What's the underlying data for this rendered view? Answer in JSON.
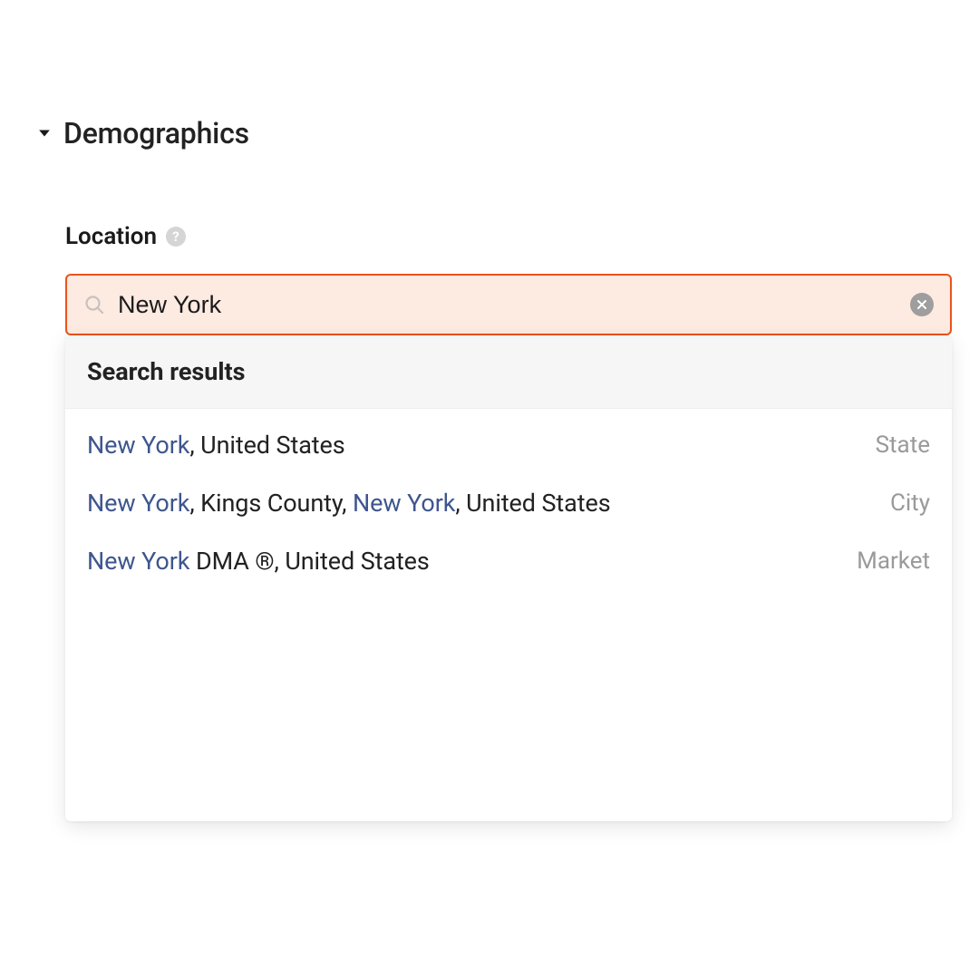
{
  "section": {
    "title": "Demographics"
  },
  "field": {
    "label": "Location",
    "help_symbol": "?"
  },
  "search": {
    "query": "New York",
    "placeholder": ""
  },
  "dropdown": {
    "header": "Search results"
  },
  "results": [
    {
      "segments": [
        {
          "text": "New York",
          "highlight": true
        },
        {
          "text": ", United States",
          "highlight": false
        }
      ],
      "type": "State"
    },
    {
      "segments": [
        {
          "text": "New York",
          "highlight": true
        },
        {
          "text": ", Kings County, ",
          "highlight": false
        },
        {
          "text": "New York",
          "highlight": true
        },
        {
          "text": ", United States",
          "highlight": false
        }
      ],
      "type": "City"
    },
    {
      "segments": [
        {
          "text": "New York",
          "highlight": true
        },
        {
          "text": " DMA ®, United States",
          "highlight": false
        }
      ],
      "type": "Market"
    }
  ],
  "colors": {
    "accent_border": "#e9531d",
    "accent_fill": "#fdeae1",
    "highlight_text": "#3e568f",
    "muted_text": "#9a9a9a"
  }
}
